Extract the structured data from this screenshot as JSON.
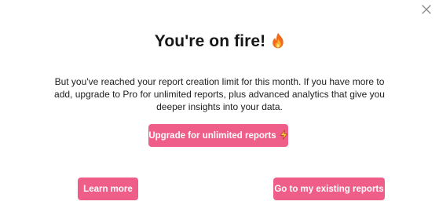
{
  "modal": {
    "title": "You're on fire!",
    "title_icon": "fire-icon",
    "body": "But you've reached your report creation limit for this month. If you have more to add, upgrade to Pro for unlimited reports, plus advanced analytics that give you deeper insights into your data.",
    "close_icon": "close-icon"
  },
  "buttons": {
    "upgrade_label": "Upgrade for unlimited reports",
    "upgrade_icon": "lightning-bolt-icon",
    "learn_more_label": "Learn more",
    "existing_reports_label": "Go to my existing reports"
  },
  "colors": {
    "accent": "#ef5e88",
    "button_text": "#ffffff",
    "title_text": "#161616",
    "body_text": "#202020",
    "background": "#ffffff",
    "close_icon": "#8a8a8a"
  }
}
